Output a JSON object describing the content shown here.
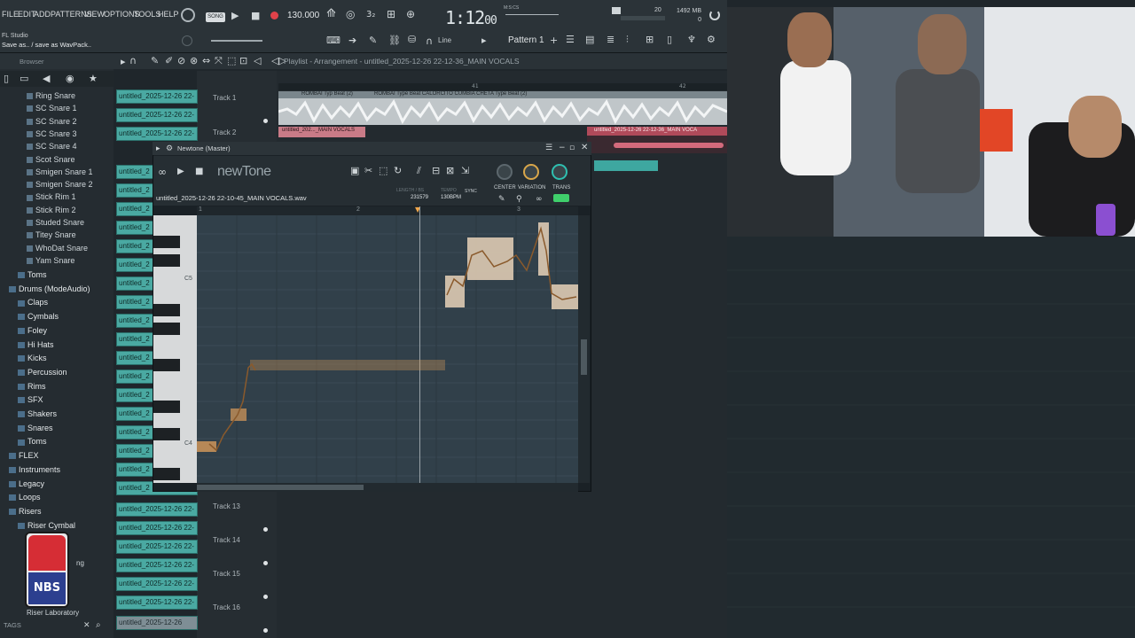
{
  "menu": [
    "FILE",
    "EDIT",
    "ADD",
    "PATTERNS",
    "VIEW",
    "OPTIONS",
    "TOOLS",
    "HELP"
  ],
  "transport": {
    "mode": "SONG",
    "tempo": "130.000",
    "time": "1:12",
    "time_sub": "00",
    "time_unit": "M:S:CS",
    "cpu_value": "20",
    "memory": "1492 MB",
    "memory_sub": "0"
  },
  "hint": {
    "app": "FL Studio",
    "message": "Save as.. / save as WavPack.."
  },
  "toolbar": {
    "snap": "Line",
    "pattern": "Pattern 1"
  },
  "browser": {
    "title": "Browser",
    "items": [
      {
        "label": "Ring Snare",
        "type": "file"
      },
      {
        "label": "SC Snare 1",
        "type": "file"
      },
      {
        "label": "SC Snare 2",
        "type": "file"
      },
      {
        "label": "SC Snare 3",
        "type": "file"
      },
      {
        "label": "SC Snare 4",
        "type": "file"
      },
      {
        "label": "Scot Snare",
        "type": "file"
      },
      {
        "label": "Smigen Snare 1",
        "type": "file"
      },
      {
        "label": "Smigen Snare 2",
        "type": "file"
      },
      {
        "label": "Stick Rim 1",
        "type": "file"
      },
      {
        "label": "Stick Rim 2",
        "type": "file"
      },
      {
        "label": "Studed Snare",
        "type": "file"
      },
      {
        "label": "Titey Snare",
        "type": "file"
      },
      {
        "label": "WhoDat Snare",
        "type": "file"
      },
      {
        "label": "Yam Snare",
        "type": "file"
      },
      {
        "label": "Toms",
        "type": "folder"
      },
      {
        "label": "Drums (ModeAudio)",
        "type": "folder"
      },
      {
        "label": "Claps",
        "type": "folder"
      },
      {
        "label": "Cymbals",
        "type": "folder"
      },
      {
        "label": "Foley",
        "type": "folder"
      },
      {
        "label": "Hi Hats",
        "type": "folder"
      },
      {
        "label": "Kicks",
        "type": "folder"
      },
      {
        "label": "Percussion",
        "type": "folder"
      },
      {
        "label": "Rims",
        "type": "folder"
      },
      {
        "label": "SFX",
        "type": "folder"
      },
      {
        "label": "Shakers",
        "type": "folder"
      },
      {
        "label": "Snares",
        "type": "folder"
      },
      {
        "label": "Toms",
        "type": "folder"
      },
      {
        "label": "FLEX",
        "type": "folder"
      },
      {
        "label": "Instruments",
        "type": "folder"
      },
      {
        "label": "Legacy",
        "type": "folder"
      },
      {
        "label": "Loops",
        "type": "folder"
      },
      {
        "label": "Risers",
        "type": "folder"
      },
      {
        "label": "Riser Cymbal",
        "type": "folder"
      }
    ],
    "footer": "TAGS",
    "overlay_logo": "NBS",
    "partial_items": [
      "ng",
      "Riser Laboratory"
    ]
  },
  "channels": {
    "full": "untitled_2025-12-26 22-",
    "short": "untitled_2",
    "last": "untitled_2025-12-26"
  },
  "playlist": {
    "title": "Playlist - Arrangement",
    "file": "untitled_2025-12-26 22-12-36_MAIN VOCALS",
    "tracks": [
      "Track 1",
      "Track 2",
      "Track 13",
      "Track 14",
      "Track 15",
      "Track 16"
    ],
    "clip1_label": "ROMBAI Typ Beat (2)",
    "clip2_label": "ROMBAI Type Beat CALORCITO CUMBIA CHETA Type Beat (2)",
    "clip3_label": "untitled_202..._MAIN VOCALS",
    "clip4_label": "untitled_2025-12-26 22-12-36_MAIN VOCA",
    "ruler_marks": [
      "41",
      "42"
    ]
  },
  "newtone": {
    "window_title": "Newtone (Master)",
    "logo": "newTone",
    "file": "untitled_2025-12-26 22-10-45_MAIN VOCALS.wav",
    "length_label": "LENGTH / BS",
    "length_value": "231579",
    "tempo_label": "TEMPO",
    "tempo_value": "130BPM",
    "sync": "SYNC",
    "knobs": [
      "CENTER",
      "VARIATION",
      "TRANS"
    ],
    "ruler": [
      "1",
      "2",
      "3"
    ],
    "key_labels": [
      "C5",
      "C4"
    ]
  },
  "colors": {
    "accent_channel": "#4aa9a2",
    "note_orange": "#d89a5a",
    "trans_knob": "#2fbfb0"
  }
}
